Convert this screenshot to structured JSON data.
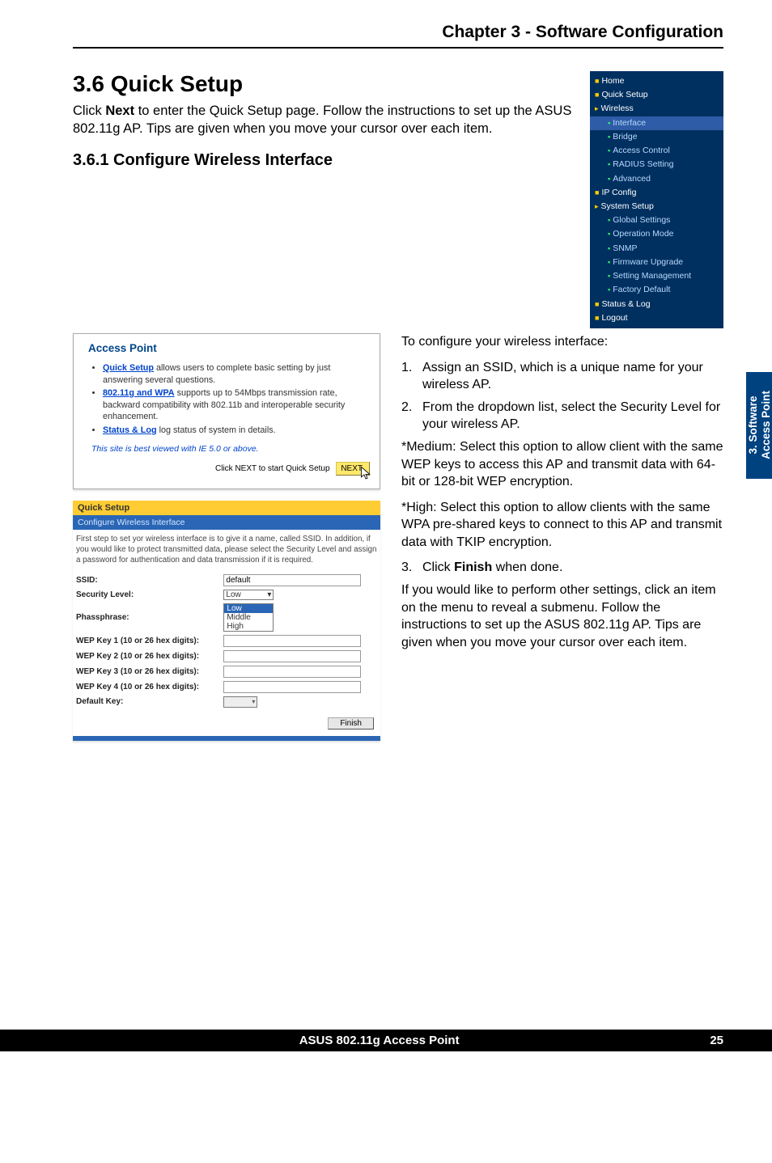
{
  "chapter_header": "Chapter 3 - Software Configuration",
  "section": {
    "number_title": "3.6       Quick Setup",
    "intro_pre": "Click ",
    "intro_bold": "Next",
    "intro_post": " to enter the Quick Setup page. Follow the instructions to set up the ASUS 802.11g AP. Tips are given when you move your cursor over each item.",
    "subsection": "3.6.1      Configure Wireless Interface"
  },
  "nav": {
    "home": "Home",
    "quick_setup": "Quick Setup",
    "wireless": "Wireless",
    "wireless_items": [
      "Interface",
      "Bridge",
      "Access Control",
      "RADIUS Setting",
      "Advanced"
    ],
    "ip_config": "IP Config",
    "system_setup": "System Setup",
    "system_items": [
      "Global Settings",
      "Operation Mode",
      "SNMP",
      "Firmware Upgrade",
      "Setting Management",
      "Factory Default"
    ],
    "status_log": "Status & Log",
    "logout": "Logout"
  },
  "ap_panel": {
    "title": "Access Point",
    "b1_link": "Quick Setup",
    "b1_rest": " allows users to complete basic setting by just answering several questions.",
    "b2_link": "802.11g and WPA",
    "b2_rest": "  supports up to 54Mbps transmission rate, backward compatibility with 802.11b and interoperable security enhancement.",
    "b3_link": "Status & Log",
    "b3_rest": " log status of system in details.",
    "ital": "This site is best viewed with IE 5.0 or above.",
    "next_label": "Click NEXT to start Quick Setup",
    "next_btn": "NEXT"
  },
  "qs": {
    "bar1": "Quick Setup",
    "bar2": "Configure Wireless Interface",
    "desc": "First step to set yor wireless interface is to give it a name, called SSID. In addition, if you would like to protect transmitted data, please select the Security Level and assign a password for authentication and data transmission if it is required.",
    "rows": {
      "ssid_lbl": "SSID:",
      "ssid_val": "default",
      "sec_lbl": "Security Level:",
      "sec_selected": "Low",
      "sec_opts": [
        "Low",
        "Middle",
        "High"
      ],
      "pass_lbl": "Phassphrase:",
      "wep1": "WEP Key 1 (10 or 26 hex digits):",
      "wep2": "WEP Key 2 (10 or 26 hex digits):",
      "wep3": "WEP Key 3 (10 or 26 hex digits):",
      "wep4": "WEP Key 4 (10 or 26 hex digits):",
      "defkey": "Default Key:"
    },
    "finish": "Finish"
  },
  "instr": {
    "lead": "To configure your wireless interface:",
    "n1": "1.",
    "t1": "Assign an SSID, which is a unique name for your wireless AP.",
    "n2": "2.",
    "t2": "From the dropdown list, select the Security Level for your wireless AP.",
    "p_med": "*Medium: Select this option to allow client with the same WEP keys to access this AP and transmit data with 64-bit or 128-bit WEP encryption.",
    "p_high": "*High: Select this option to allow clients with the same WPA pre-shared keys to connect to this AP and transmit data with TKIP encryption.",
    "n3": "3.",
    "t3_pre": "Click ",
    "t3_bold": "Finish",
    "t3_post": " when done.",
    "p_last": "If you would like to perform other settings, click an item on the menu to reveal a submenu. Follow the instructions to set up the ASUS 802.11g AP. Tips are given when you move your cursor over each item."
  },
  "side_tab": {
    "l1": "3. Software",
    "l2": "Access Point"
  },
  "footer": {
    "center": "ASUS 802.11g Access Point",
    "page": "25"
  }
}
